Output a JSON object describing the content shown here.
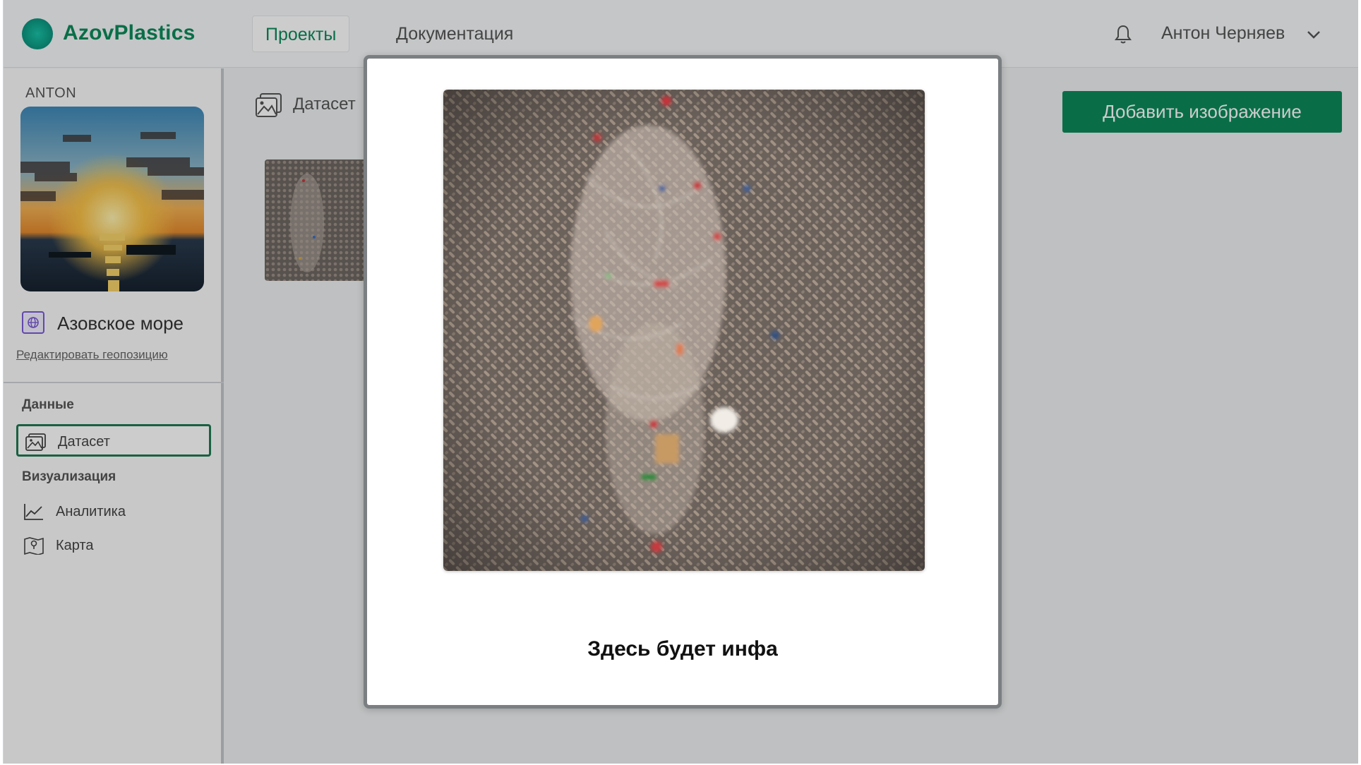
{
  "header": {
    "logo_text": "AzovPlastics",
    "nav": [
      {
        "label": "Проекты",
        "active": true
      },
      {
        "label": "Документация",
        "active": false
      }
    ],
    "user_name": "Антон Черняев",
    "accent_color": "#0c8a5a"
  },
  "sidebar": {
    "username": "ANTON",
    "location_label": "Азовское море",
    "edit_location_link": "Редактировать геопозицию",
    "sections": [
      {
        "title": "Данные",
        "items": [
          {
            "label": "Датасет",
            "icon": "image-icon",
            "active": true
          }
        ]
      },
      {
        "title": "Визуализация",
        "items": [
          {
            "label": "Аналитика",
            "icon": "chart-line-icon",
            "active": false
          },
          {
            "label": "Карта",
            "icon": "map-pin-icon",
            "active": false
          }
        ]
      }
    ]
  },
  "main": {
    "breadcrumb": "Датасет",
    "add_button": "Добавить изображение"
  },
  "modal": {
    "caption": "Здесь будет инфа"
  }
}
